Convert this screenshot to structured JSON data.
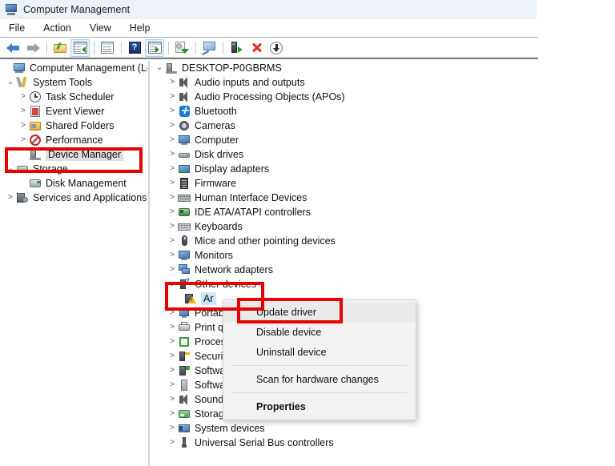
{
  "window": {
    "title": "Computer Management",
    "icon": "computer-management-icon"
  },
  "menubar": {
    "items": [
      {
        "label": "File",
        "name": "menu-file"
      },
      {
        "label": "Action",
        "name": "menu-action"
      },
      {
        "label": "View",
        "name": "menu-view"
      },
      {
        "label": "Help",
        "name": "menu-help"
      }
    ]
  },
  "toolbar": {
    "buttons": [
      {
        "icon": "back-arrow-icon",
        "framed": false
      },
      {
        "icon": "forward-arrow-icon",
        "framed": false
      },
      {
        "icon": "up-folder-icon",
        "framed": false
      },
      {
        "icon": "show-hide-console-tree-icon",
        "framed": true
      },
      {
        "icon": "properties-window-icon",
        "framed": false
      },
      {
        "icon": "help-icon",
        "framed": false
      },
      {
        "icon": "show-action-pane-icon",
        "framed": true
      },
      {
        "icon": "scan-hardware-changes-icon",
        "framed": false
      },
      {
        "icon": "console-view-icon",
        "framed": false
      },
      {
        "icon": "connect-device-icon",
        "framed": false
      },
      {
        "icon": "uninstall-device-icon",
        "framed": false
      },
      {
        "icon": "update-driver-icon",
        "framed": false
      }
    ]
  },
  "sidebar": {
    "items": [
      {
        "label": "Computer Management (Local",
        "indent": 0,
        "chevron": "",
        "icon": "computer-management-icon",
        "name": "sidebar-item-computer-management"
      },
      {
        "label": "System Tools",
        "indent": 1,
        "chevron": "v",
        "icon": "system-tools-icon",
        "name": "sidebar-item-system-tools"
      },
      {
        "label": "Task Scheduler",
        "indent": 2,
        "chevron": ">",
        "icon": "task-scheduler-icon",
        "name": "sidebar-item-task-scheduler"
      },
      {
        "label": "Event Viewer",
        "indent": 2,
        "chevron": ">",
        "icon": "event-viewer-icon",
        "name": "sidebar-item-event-viewer"
      },
      {
        "label": "Shared Folders",
        "indent": 2,
        "chevron": ">",
        "icon": "shared-folders-icon",
        "name": "sidebar-item-shared-folders"
      },
      {
        "label": "Performance",
        "indent": 2,
        "chevron": ">",
        "icon": "performance-icon",
        "name": "sidebar-item-performance"
      },
      {
        "label": "Device Manager",
        "indent": 2,
        "chevron": "",
        "icon": "device-manager-icon",
        "name": "sidebar-item-device-manager",
        "selected": true
      },
      {
        "label": "Storage",
        "indent": 1,
        "chevron": "v",
        "icon": "storage-icon",
        "name": "sidebar-item-storage"
      },
      {
        "label": "Disk Management",
        "indent": 2,
        "chevron": "",
        "icon": "disk-management-icon",
        "name": "sidebar-item-disk-management"
      },
      {
        "label": "Services and Applications",
        "indent": 1,
        "chevron": ">",
        "icon": "services-applications-icon",
        "name": "sidebar-item-services-and-applications"
      }
    ]
  },
  "device_tree": {
    "items": [
      {
        "label": "DESKTOP-P0GBRMS",
        "indent": 0,
        "chevron": "v",
        "icon": "computer-root-icon",
        "name": "tree-item-desktop-root"
      },
      {
        "label": "Audio inputs and outputs",
        "indent": 1,
        "chevron": ">",
        "icon": "speaker-icon",
        "name": "tree-item-audio-inputs-outputs"
      },
      {
        "label": "Audio Processing Objects (APOs)",
        "indent": 1,
        "chevron": ">",
        "icon": "speaker-icon",
        "name": "tree-item-audio-processing-objects"
      },
      {
        "label": "Bluetooth",
        "indent": 1,
        "chevron": ">",
        "icon": "bluetooth-icon",
        "name": "tree-item-bluetooth"
      },
      {
        "label": "Cameras",
        "indent": 1,
        "chevron": ">",
        "icon": "camera-icon",
        "name": "tree-item-cameras"
      },
      {
        "label": "Computer",
        "indent": 1,
        "chevron": ">",
        "icon": "computer-icon",
        "name": "tree-item-computer"
      },
      {
        "label": "Disk drives",
        "indent": 1,
        "chevron": ">",
        "icon": "disk-drive-icon",
        "name": "tree-item-disk-drives"
      },
      {
        "label": "Display adapters",
        "indent": 1,
        "chevron": ">",
        "icon": "display-adapter-icon",
        "name": "tree-item-display-adapters"
      },
      {
        "label": "Firmware",
        "indent": 1,
        "chevron": ">",
        "icon": "firmware-chip-icon",
        "name": "tree-item-firmware"
      },
      {
        "label": "Human Interface Devices",
        "indent": 1,
        "chevron": ">",
        "icon": "hid-icon",
        "name": "tree-item-human-interface-devices"
      },
      {
        "label": "IDE ATA/ATAPI controllers",
        "indent": 1,
        "chevron": ">",
        "icon": "ide-controller-icon",
        "name": "tree-item-ide-ata-atapi-controllers"
      },
      {
        "label": "Keyboards",
        "indent": 1,
        "chevron": ">",
        "icon": "keyboard-icon",
        "name": "tree-item-keyboards"
      },
      {
        "label": "Mice and other pointing devices",
        "indent": 1,
        "chevron": ">",
        "icon": "mouse-icon",
        "name": "tree-item-mice-and-pointing-devices"
      },
      {
        "label": "Monitors",
        "indent": 1,
        "chevron": ">",
        "icon": "monitor-icon",
        "name": "tree-item-monitors"
      },
      {
        "label": "Network adapters",
        "indent": 1,
        "chevron": ">",
        "icon": "network-adapter-icon",
        "name": "tree-item-network-adapters"
      },
      {
        "label": "Other devices",
        "indent": 1,
        "chevron": "v",
        "icon": "other-devices-icon",
        "name": "tree-item-other-devices"
      },
      {
        "label": "Ar",
        "indent": 2,
        "chevron": "",
        "icon": "unknown-device-warning-icon",
        "name": "tree-item-unknown-device",
        "selected_blue": true
      },
      {
        "label": "Portable Devices",
        "indent": 1,
        "chevron": ">",
        "icon": "portable-device-icon",
        "name": "tree-item-portable-devices"
      },
      {
        "label": "Print queues",
        "indent": 1,
        "chevron": ">",
        "icon": "printer-icon",
        "name": "tree-item-print-queues"
      },
      {
        "label": "Processors",
        "indent": 1,
        "chevron": ">",
        "icon": "processor-icon",
        "name": "tree-item-processors"
      },
      {
        "label": "Security devices",
        "indent": 1,
        "chevron": ">",
        "icon": "security-device-icon",
        "name": "tree-item-security-devices"
      },
      {
        "label": "Software components",
        "indent": 1,
        "chevron": ">",
        "icon": "software-component-icon",
        "name": "tree-item-software-components"
      },
      {
        "label": "Software devices",
        "indent": 1,
        "chevron": ">",
        "icon": "software-device-icon",
        "name": "tree-item-software-devices"
      },
      {
        "label": "Sound, video and game controllers",
        "indent": 1,
        "chevron": ">",
        "icon": "speaker-icon",
        "name": "tree-item-sound-video-game-controllers"
      },
      {
        "label": "Storage controllers",
        "indent": 1,
        "chevron": ">",
        "icon": "storage-controller-icon",
        "name": "tree-item-storage-controllers"
      },
      {
        "label": "System devices",
        "indent": 1,
        "chevron": ">",
        "icon": "system-device-icon",
        "name": "tree-item-system-devices"
      },
      {
        "label": "Universal Serial Bus controllers",
        "indent": 1,
        "chevron": ">",
        "icon": "usb-icon",
        "name": "tree-item-universal-serial-bus-controllers"
      }
    ]
  },
  "context_menu": {
    "items": [
      {
        "label": "Update driver",
        "type": "item",
        "highlighted": true,
        "name": "context-menu-update-driver"
      },
      {
        "label": "Disable device",
        "type": "item",
        "highlighted": false,
        "name": "context-menu-disable-device"
      },
      {
        "label": "Uninstall device",
        "type": "item",
        "highlighted": false,
        "name": "context-menu-uninstall-device"
      },
      {
        "label": "",
        "type": "separator",
        "name": "context-menu-separator-1"
      },
      {
        "label": "Scan for hardware changes",
        "type": "item",
        "highlighted": false,
        "name": "context-menu-scan-for-hardware-changes"
      },
      {
        "label": "",
        "type": "separator",
        "name": "context-menu-separator-2"
      },
      {
        "label": "Properties",
        "type": "item",
        "highlighted": false,
        "bold": true,
        "name": "context-menu-properties"
      }
    ]
  },
  "annotations": {
    "color": "#e60000",
    "boxes": [
      {
        "target": "Device Manager",
        "name": "annotation-box-device-manager"
      },
      {
        "target": "Other devices",
        "name": "annotation-box-other-devices"
      },
      {
        "target": "Update driver",
        "name": "annotation-box-update-driver"
      }
    ]
  }
}
